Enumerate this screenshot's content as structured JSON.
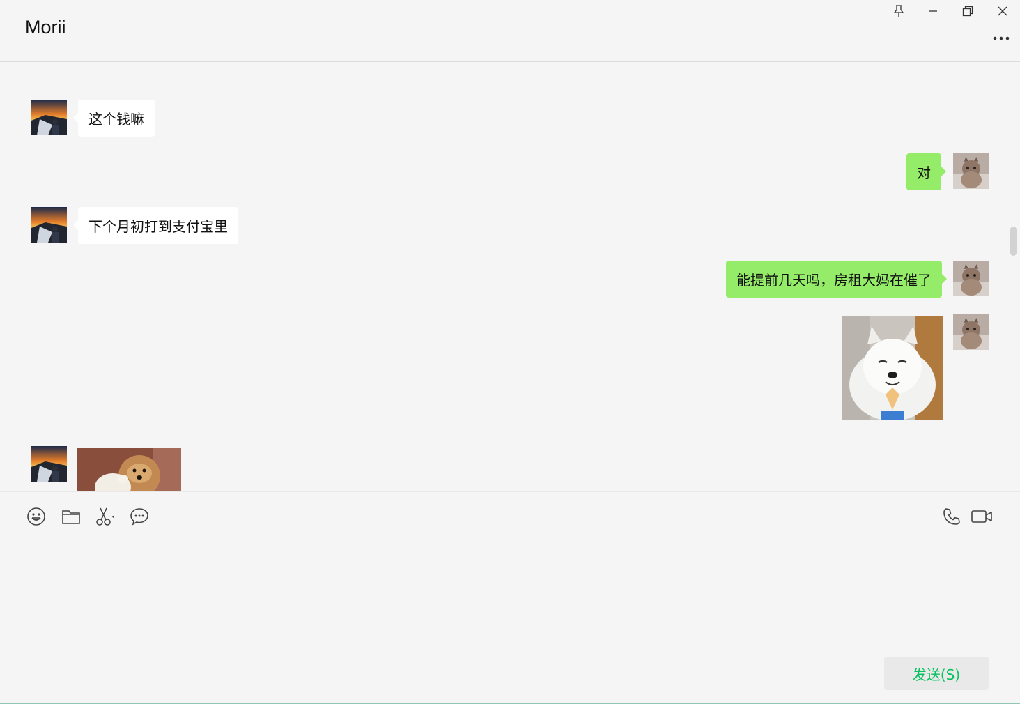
{
  "header": {
    "title": "Morii",
    "pin_icon": "pin-icon",
    "minimize_icon": "minimize-icon",
    "restore_icon": "restore-icon",
    "close_icon": "close-icon",
    "more_icon": "more-icon"
  },
  "messages": [
    {
      "direction": "in",
      "type": "text",
      "text": "这个钱嘛"
    },
    {
      "direction": "out",
      "type": "text",
      "text": "对"
    },
    {
      "direction": "in",
      "type": "text",
      "text": "下个月初打到支付宝里"
    },
    {
      "direction": "out",
      "type": "text",
      "text": "能提前几天吗，房租大妈在催了"
    },
    {
      "direction": "out",
      "type": "image",
      "content": "samoyed-praying-sticker"
    },
    {
      "direction": "in",
      "type": "image",
      "content": "puppy-and-duck-sticker"
    }
  ],
  "toolbar": {
    "left": [
      "emoji-icon",
      "folder-icon",
      "scissors-icon",
      "chat-bubble-icon"
    ],
    "right": [
      "phone-icon",
      "video-icon"
    ]
  },
  "input": {
    "value": ""
  },
  "send": {
    "label": "发送(S)"
  },
  "colors": {
    "outgoing_bubble": "#95ec69",
    "incoming_bubble": "#ffffff",
    "send_text": "#07c160",
    "background": "#f5f5f5"
  }
}
